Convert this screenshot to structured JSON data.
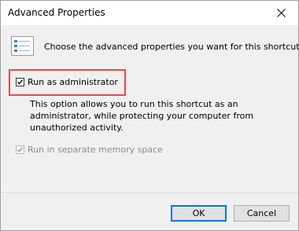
{
  "window": {
    "title": "Advanced Properties"
  },
  "header": {
    "text": "Choose the advanced properties you want for this shortcut.",
    "icon": "property-sheet-icon"
  },
  "options": {
    "run_as_admin": {
      "label": "Run as administrator",
      "checked": true
    },
    "description": "This option allows you to run this shortcut as an administrator, while protecting your computer from unauthorized activity.",
    "separate_memory": {
      "label": "Run in separate memory space",
      "checked": true,
      "enabled": false
    }
  },
  "buttons": {
    "ok": "OK",
    "cancel": "Cancel"
  },
  "colors": {
    "highlight": "#e8484b",
    "accent": "#0078d7",
    "dialog_bg": "#f0f0f0"
  }
}
